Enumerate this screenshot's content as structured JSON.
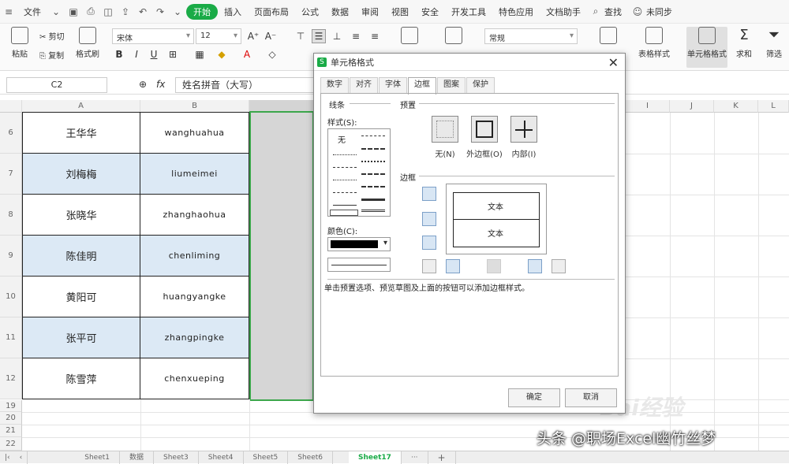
{
  "menubar": {
    "file_menu": "文件",
    "items": [
      "插入",
      "页面布局",
      "公式",
      "数据",
      "审阅",
      "视图",
      "安全",
      "开发工具",
      "特色应用",
      "文档助手"
    ],
    "active_tab": "开始",
    "search": "查找",
    "user": "未同步"
  },
  "ribbon": {
    "paste": "粘贴",
    "cut": "剪切",
    "copy": "复制",
    "format_painter": "格式刷",
    "font_name": "宋体",
    "font_size": "12",
    "bold": "B",
    "italic": "I",
    "underline": "U",
    "number_format": "常规",
    "table_style": "表格样式",
    "cell_format": "单元格格式",
    "sum": "求和",
    "filter": "筛选"
  },
  "formulabar": {
    "cell_ref": "C2",
    "fx": "fx",
    "content": "姓名拼音（大写）"
  },
  "sheet": {
    "columns": [
      "A",
      "B",
      "",
      "",
      "",
      "",
      "",
      "",
      "",
      "I",
      "J",
      "K",
      "L"
    ],
    "rows": [
      {
        "num": "6",
        "name": "王华华",
        "pinyin": "wanghuahua",
        "shaded": false
      },
      {
        "num": "7",
        "name": "刘梅梅",
        "pinyin": "liumeimei",
        "shaded": true
      },
      {
        "num": "8",
        "name": "张晓华",
        "pinyin": "zhanghaohua",
        "shaded": false
      },
      {
        "num": "9",
        "name": "陈佳明",
        "pinyin": "chenliming",
        "shaded": true
      },
      {
        "num": "10",
        "name": "黄阳可",
        "pinyin": "huangyangke",
        "shaded": false
      },
      {
        "num": "11",
        "name": "张平可",
        "pinyin": "zhangpingke",
        "shaded": true
      },
      {
        "num": "12",
        "name": "陈雪萍",
        "pinyin": "chenxueping",
        "shaded": false
      }
    ],
    "extra_rows": [
      "19",
      "20",
      "21",
      "22"
    ]
  },
  "dialog": {
    "title": "单元格格式",
    "tabs": [
      "数字",
      "对齐",
      "字体",
      "边框",
      "图案",
      "保护"
    ],
    "active_tab": "边框",
    "line_section": "线条",
    "style_label": "样式(S):",
    "none_style": "无",
    "color_label": "颜色(C):",
    "preset_section": "预置",
    "presets": [
      "无(N)",
      "外边框(O)",
      "内部(I)"
    ],
    "border_section": "边框",
    "preview_text": "文本",
    "hint": "单击预置选项、预览草图及上面的按钮可以添加边框样式。",
    "ok": "确定",
    "cancel": "取消"
  },
  "tabs": {
    "sheets": [
      "Sheet1",
      "数据",
      "Sheet3",
      "Sheet4",
      "Sheet5",
      "Sheet6"
    ],
    "active": "Sheet17",
    "more": "···",
    "add": "+"
  },
  "watermark": "头条 @职场Excel幽竹丝梦",
  "baidu": "Bai经验"
}
